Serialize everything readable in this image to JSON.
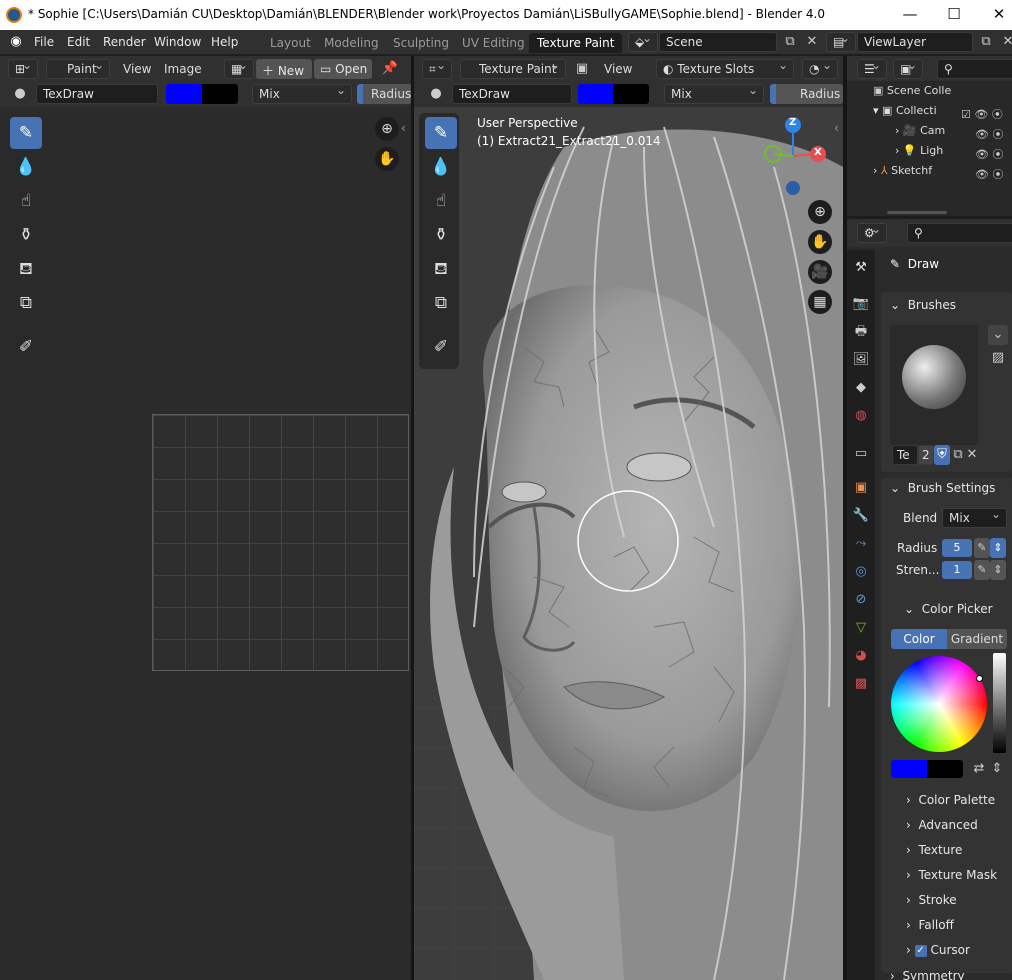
{
  "window": {
    "title": "* Sophie [C:\\Users\\Damián CU\\Desktop\\Damián\\BLENDER\\Blender work\\Proyectos Damián\\LiSBullyGAME\\Sophie.blend] - Blender 4.0",
    "minimize": "—",
    "maximize": "☐",
    "close": "✕"
  },
  "menu": [
    "File",
    "Edit",
    "Render",
    "Window",
    "Help"
  ],
  "workspaces": [
    "Layout",
    "Modeling",
    "Sculpting",
    "UV Editing",
    "Texture Paint"
  ],
  "scene": {
    "label": "Scene",
    "view_layer": "ViewLayer"
  },
  "image_editor": {
    "mode": "Paint",
    "view": "View",
    "image": "Image",
    "new": "New",
    "open": "Open",
    "brush": "TexDraw",
    "blend": "Mix",
    "radius": "Radius"
  },
  "viewport": {
    "mode": "Texture Paint",
    "view": "View",
    "slots": "Texture Slots",
    "brush": "TexDraw",
    "blend": "Mix",
    "radius": "Radius",
    "perspective": "User Perspective",
    "object": "(1) Extract21_Extract21_0.014",
    "axes": {
      "z": "Z",
      "x": "X"
    }
  },
  "outliner": {
    "root": "Scene Colle",
    "items": [
      {
        "label": "Collecti"
      },
      {
        "label": "Cam"
      },
      {
        "label": "Ligh"
      },
      {
        "label": "Sketchf"
      }
    ]
  },
  "properties": {
    "tool": "Draw",
    "brushes": "Brushes",
    "brush_name_short": "Te",
    "brush_users": "2",
    "brush_settings": "Brush Settings",
    "blend_label": "Blend",
    "blend_value": "Mix",
    "radius_label": "Radius",
    "radius_value": "5",
    "strength_label": "Stren...",
    "strength_value": "1",
    "color_picker": "Color Picker",
    "color_tab": "Color",
    "gradient_tab": "Gradient",
    "subpanels": [
      "Color Palette",
      "Advanced",
      "Texture",
      "Texture Mask",
      "Stroke",
      "Falloff",
      "Cursor",
      "Symmetry"
    ]
  },
  "colors": {
    "primary": "#0000ff",
    "secondary": "#000000",
    "accent": "#4772b3"
  }
}
